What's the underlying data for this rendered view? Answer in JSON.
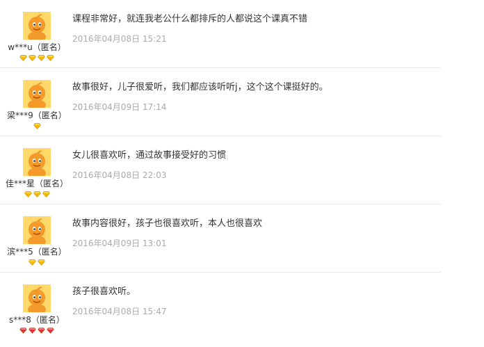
{
  "reviews": [
    {
      "user": "w***u（匿名）",
      "comment": "课程非常好，就连我老公什么都排斥的人都说这个课真不错",
      "date": "2016年04月08日 15:21",
      "level_icon": "gold-diamond-icon",
      "level_count": 4,
      "level_color": "#f5b800"
    },
    {
      "user": "梁***9（匿名）",
      "comment": "故事很好，儿子很爱听，我们都应该听听j，这个这个课挺好的。",
      "date": "2016年04月09日 17:14",
      "level_icon": "gold-diamond-icon",
      "level_count": 1,
      "level_color": "#f5b800"
    },
    {
      "user": "佳***星（匿名）",
      "comment": "女儿很喜欢听，通过故事接受好的习惯",
      "date": "2016年04月08日 22:03",
      "level_icon": "gold-diamond-icon",
      "level_count": 3,
      "level_color": "#f5b800"
    },
    {
      "user": "滨***5（匿名）",
      "comment": "故事内容很好，孩子也很喜欢听，本人也很喜欢",
      "date": "2016年04月09日 13:01",
      "level_icon": "gold-diamond-icon",
      "level_count": 2,
      "level_color": "#f5b800"
    },
    {
      "user": "s***8（匿名）",
      "comment": "孩子很喜欢听。",
      "date": "2016年04月08日 15:47",
      "level_icon": "red-diamond-icon",
      "level_count": 4,
      "level_color": "#e0323c"
    }
  ],
  "colors": {
    "avatar_orange": "#f39a2b",
    "avatar_bg": "#ffd86a",
    "text": "#333333",
    "date_gray": "#aaaaaa",
    "divider": "#e6e6e6"
  }
}
